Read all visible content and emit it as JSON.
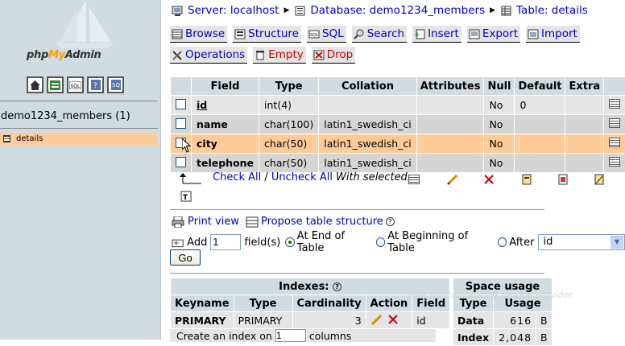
{
  "sidebar": {
    "brand_pre": "php",
    "brand_my": "My",
    "brand_post": "Admin",
    "nav_icons": [
      "home-icon",
      "query-window-icon",
      "sql-icon",
      "docs-icon",
      "changelog-icon"
    ],
    "db_name": "demo1234_members (1)",
    "table_link": "details"
  },
  "breadcrumb": {
    "server": "Server: localhost",
    "database": "Database: demo1234_members",
    "table": "Table: details"
  },
  "tabs_row1": [
    {
      "label": "Browse",
      "icon": "browse-icon"
    },
    {
      "label": "Structure",
      "icon": "structure-icon"
    },
    {
      "label": "SQL",
      "icon": "sql-icon"
    },
    {
      "label": "Search",
      "icon": "search-icon"
    },
    {
      "label": "Insert",
      "icon": "insert-icon"
    },
    {
      "label": "Export",
      "icon": "export-icon"
    },
    {
      "label": "Import",
      "icon": "import-icon"
    }
  ],
  "tabs_row2": [
    {
      "label": "Operations",
      "icon": "operations-icon"
    },
    {
      "label": "Empty",
      "icon": "empty-icon"
    },
    {
      "label": "Drop",
      "icon": "drop-icon"
    }
  ],
  "structure": {
    "headers": [
      "Field",
      "Type",
      "Collation",
      "Attributes",
      "Null",
      "Default",
      "Extra"
    ],
    "rows": [
      {
        "field": "id",
        "type": "int(4)",
        "collation": "",
        "attributes": "",
        "null": "No",
        "default": "0",
        "extra": ""
      },
      {
        "field": "name",
        "type": "char(100)",
        "collation": "latin1_swedish_ci",
        "attributes": "",
        "null": "No",
        "default": "",
        "extra": ""
      },
      {
        "field": "city",
        "type": "char(50)",
        "collation": "latin1_swedish_ci",
        "attributes": "",
        "null": "No",
        "default": "",
        "extra": ""
      },
      {
        "field": "telephone",
        "type": "char(50)",
        "collation": "latin1_swedish_ci",
        "attributes": "",
        "null": "No",
        "default": "",
        "extra": ""
      }
    ]
  },
  "selection": {
    "check_all": "Check All",
    "slash": " / ",
    "uncheck_all": "Uncheck All",
    "with_selected": "With selected:"
  },
  "print_view": "Print view",
  "propose": "Propose table structure",
  "add": {
    "label": "Add",
    "count": "1",
    "fields_label": "field(s)",
    "at_end": "At End of Table",
    "at_begin": "At Beginning of Table",
    "after": "After",
    "after_value": "id",
    "go": "Go"
  },
  "indexes": {
    "title": "Indexes:",
    "headers": [
      "Keyname",
      "Type",
      "Cardinality",
      "Action",
      "Field"
    ],
    "row": {
      "keyname": "PRIMARY",
      "type": "PRIMARY",
      "cardinality": "3",
      "field": "id"
    },
    "create_pre": "Create an index on",
    "create_count": "1",
    "create_post": "columns",
    "go": "Go"
  },
  "space": {
    "title": "Space usage",
    "headers": [
      "Type",
      "Usage"
    ],
    "rows": [
      {
        "type": "Data",
        "value": "616",
        "unit": "B"
      },
      {
        "type": "Index",
        "value": "2,048",
        "unit": "B"
      }
    ]
  },
  "watermark": "your trusted hosting service provider",
  "colors": {
    "sidebar_bg": "#d0dce0",
    "row_highlight": "#ffcc99",
    "link": "#0000cc",
    "header_bg": "#d0dce0"
  }
}
